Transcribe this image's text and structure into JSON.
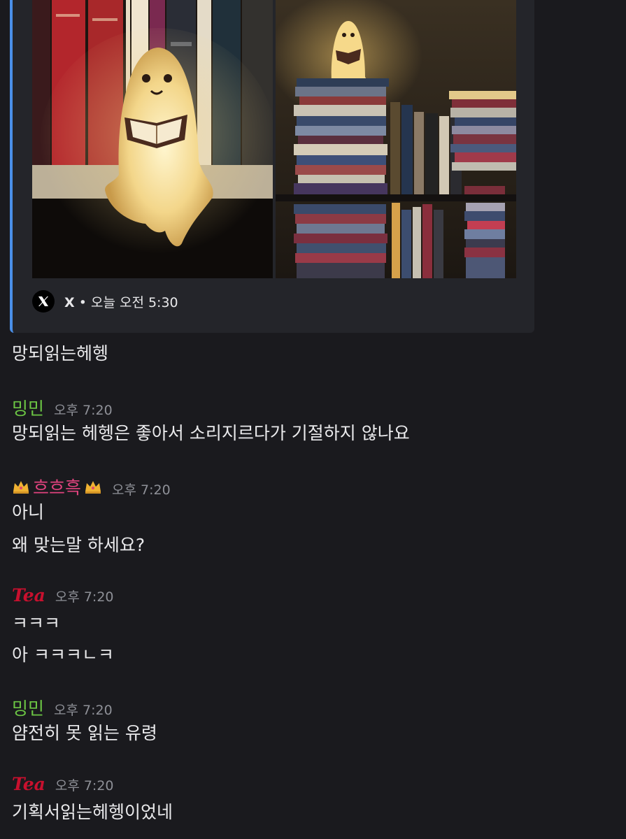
{
  "embed": {
    "source": "X",
    "separator": "•",
    "time": "오늘 오전 5:30",
    "accent_color": "#4a8fe8"
  },
  "messages": [
    {
      "id": "m0",
      "lines": [
        "망되읽는헤헹"
      ]
    },
    {
      "id": "m1",
      "author": "밍민",
      "author_color": "#6cc644",
      "time": "오후 7:20",
      "lines": [
        "망되읽는 헤헹은 좋아서 소리지르다가 기절하지 않나요"
      ]
    },
    {
      "id": "m2",
      "author": "흐흐흑",
      "author_color": "#e0437e",
      "time": "오후 7:20",
      "decor_icon": "crown-icon",
      "lines": [
        "아니",
        "왜 맞는말 하세요?"
      ]
    },
    {
      "id": "m3",
      "author": "Tea",
      "author_color": "#c8102e",
      "time": "오후 7:20",
      "lines": [
        "ㅋㅋㅋ",
        "아 ㅋㅋㅋㄴㅋ"
      ]
    },
    {
      "id": "m4",
      "author": "밍민",
      "author_color": "#6cc644",
      "time": "오후 7:20",
      "lines": [
        "얌전히 못 읽는 유령"
      ]
    },
    {
      "id": "m5",
      "author": "Tea",
      "author_color": "#c8102e",
      "time": "오후 7:20",
      "lines": [
        "기획서읽는헤헹이었네"
      ]
    }
  ]
}
